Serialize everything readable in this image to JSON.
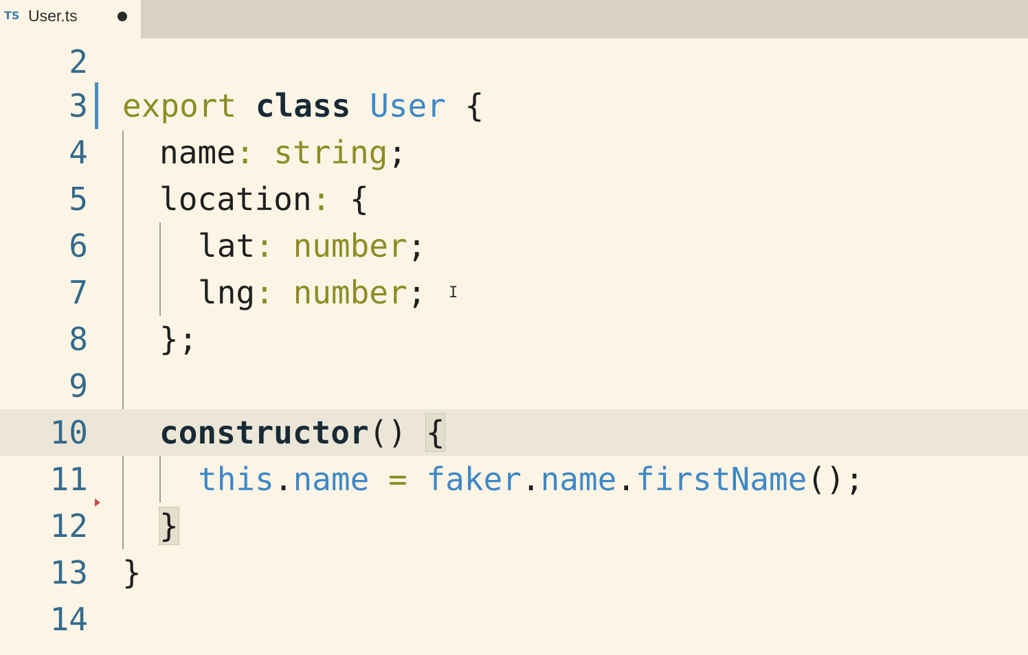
{
  "tab": {
    "lang_badge": "TS",
    "title": "User.ts",
    "dirty": true
  },
  "editor": {
    "current_line": 10,
    "cursor": "I",
    "lines": [
      {
        "num": "2"
      },
      {
        "num": "3",
        "tokens": [
          "export",
          "class",
          "User",
          "{"
        ]
      },
      {
        "num": "4",
        "tokens": [
          "name",
          ":",
          "string",
          ";"
        ]
      },
      {
        "num": "5",
        "tokens": [
          "location",
          ":",
          "{"
        ]
      },
      {
        "num": "6",
        "tokens": [
          "lat",
          ":",
          "number",
          ";"
        ]
      },
      {
        "num": "7",
        "tokens": [
          "lng",
          ":",
          "number",
          ";"
        ]
      },
      {
        "num": "8",
        "tokens": [
          "};"
        ]
      },
      {
        "num": "9"
      },
      {
        "num": "10",
        "tokens": [
          "constructor",
          "()",
          "{"
        ]
      },
      {
        "num": "11",
        "tokens": [
          "this",
          ".",
          "name",
          "=",
          "faker",
          ".",
          "name",
          ".",
          "firstName",
          "();"
        ]
      },
      {
        "num": "12",
        "tokens": [
          "}"
        ]
      },
      {
        "num": "13",
        "tokens": [
          "}"
        ]
      },
      {
        "num": "14"
      }
    ]
  }
}
